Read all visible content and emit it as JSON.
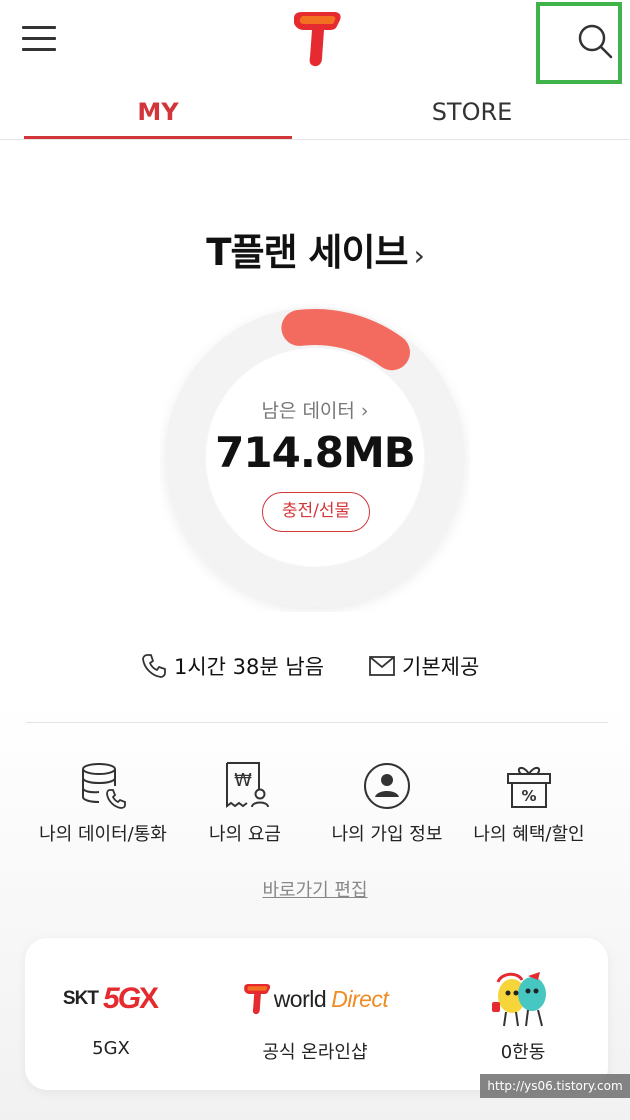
{
  "tabs": {
    "my": "MY",
    "store": "STORE"
  },
  "plan": {
    "name": "T플랜 세이브",
    "chevron": "›"
  },
  "data_usage": {
    "label": "남은 데이터 ›",
    "remaining": "714.8MB",
    "remaining_fraction": 0.12,
    "charge_button": "충전/선물"
  },
  "stats": {
    "call_remaining": "1시간 38분 남음",
    "sms": "기본제공"
  },
  "quick_menu": [
    {
      "label": "나의 데이터/통화",
      "icon": "database-phone-icon"
    },
    {
      "label": "나의 요금",
      "icon": "bill-won-icon"
    },
    {
      "label": "나의 가입 정보",
      "icon": "user-circle-icon"
    },
    {
      "label": "나의 혜택/할인",
      "icon": "gift-percent-icon"
    }
  ],
  "edit_shortcuts": "바로가기 편집",
  "promos": [
    {
      "label": "5GX",
      "logo_skt": "SKT",
      "logo_5g": "5G",
      "logo_x": "X"
    },
    {
      "label": "공식 온라인샵",
      "logo_world": "world",
      "logo_direct": "Direct"
    },
    {
      "label": "0한동",
      "icon": "0-characters-icon"
    }
  ],
  "watermark": "http://ys06.tistory.com",
  "colors": {
    "accent": "#d3363a",
    "ring_fill": "#f26b5e",
    "highlight_box": "#3fb24a"
  }
}
